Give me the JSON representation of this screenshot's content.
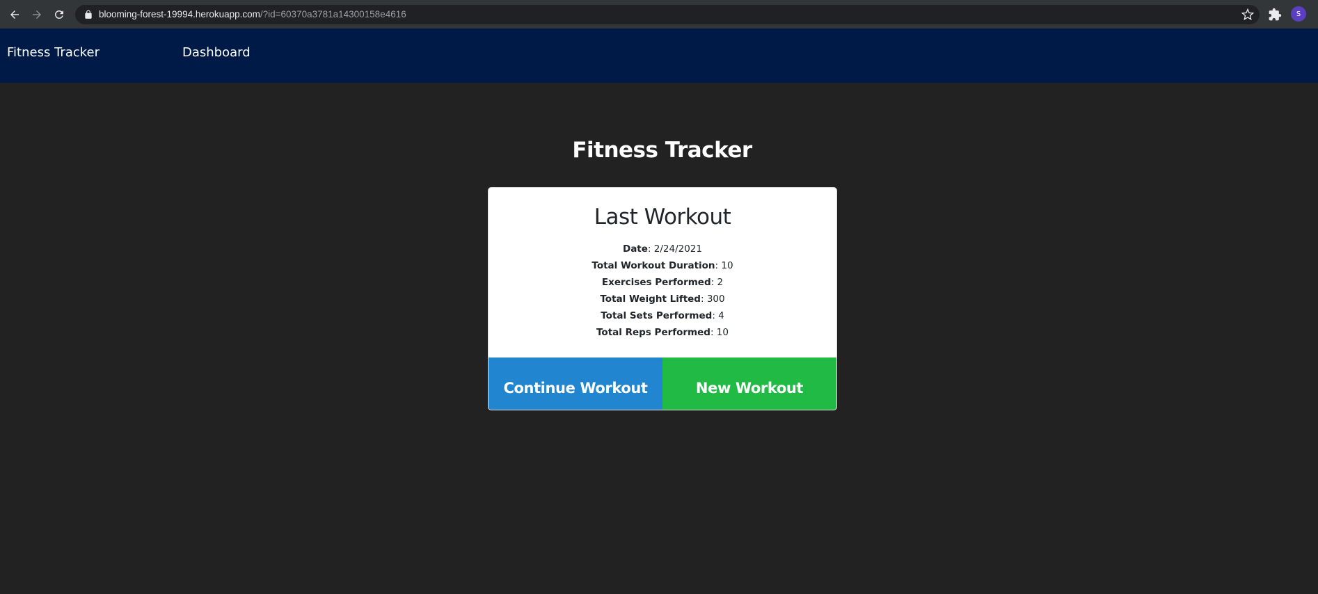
{
  "browser": {
    "url_host": "blooming-forest-19994.herokuapp.com",
    "url_path": "/?id=60370a3781a14300158e4616",
    "profile_initial": "S"
  },
  "navbar": {
    "brand": "Fitness Tracker",
    "links": [
      "Dashboard"
    ]
  },
  "main": {
    "title": "Fitness Tracker",
    "card": {
      "title": "Last Workout",
      "stats": [
        {
          "label": "Date",
          "value": "2/24/2021"
        },
        {
          "label": "Total Workout Duration",
          "value": "10"
        },
        {
          "label": "Exercises Performed",
          "value": "2"
        },
        {
          "label": "Total Weight Lifted",
          "value": "300"
        },
        {
          "label": "Total Sets Performed",
          "value": "4"
        },
        {
          "label": "Total Reps Performed",
          "value": "10"
        }
      ],
      "buttons": {
        "continue": "Continue Workout",
        "new": "New Workout"
      }
    }
  },
  "colors": {
    "background": "#222222",
    "navbar": "#001a47",
    "continue_button": "#2185d0",
    "new_button": "#21ba45"
  },
  "icons": [
    "back-arrow-icon",
    "forward-arrow-icon",
    "reload-icon",
    "lock-icon",
    "star-icon",
    "extensions-puzzle-icon"
  ]
}
